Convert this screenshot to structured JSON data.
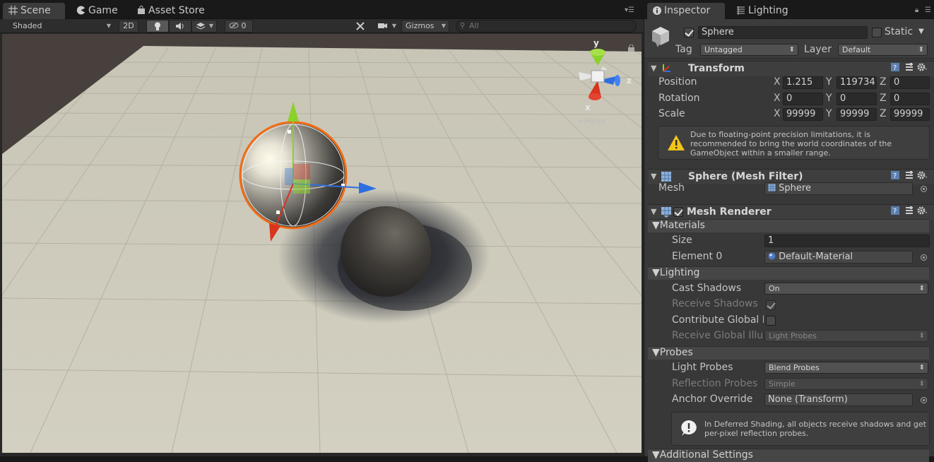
{
  "scene_tabs": [
    {
      "label": "Scene",
      "icon": "grid-icon"
    },
    {
      "label": "Game",
      "icon": "pacman-icon"
    },
    {
      "label": "Asset Store",
      "icon": "bag-icon"
    }
  ],
  "scene_toolbar": {
    "draw_mode": "Shaded",
    "mode_2d": "2D",
    "hidden_count": "0",
    "gizmos": "Gizmos",
    "search_placeholder": "All"
  },
  "viewport": {
    "gizmo_axes": {
      "y": "y",
      "z": "z",
      "x": "x"
    },
    "projection_label": "Persp"
  },
  "inspector_tabs": [
    {
      "label": "Inspector",
      "icon": "info-icon"
    },
    {
      "label": "Lighting",
      "icon": "lighting-icon"
    }
  ],
  "object": {
    "active": true,
    "name": "Sphere",
    "static_label": "Static",
    "static": false,
    "tag_label": "Tag",
    "tag": "Untagged",
    "layer_label": "Layer",
    "layer": "Default"
  },
  "transform": {
    "title": "Transform",
    "position_label": "Position",
    "rotation_label": "Rotation",
    "scale_label": "Scale",
    "axis_x": "X",
    "axis_y": "Y",
    "axis_z": "Z",
    "position": {
      "x": "1.215",
      "y": "119734",
      "z": "0"
    },
    "rotation": {
      "x": "0",
      "y": "0",
      "z": "0"
    },
    "scale": {
      "x": "99999",
      "y": "99999",
      "z": "99999"
    },
    "warning": "Due to floating-point precision limitations, it is recommended to bring the world coordinates of the GameObject within a smaller range."
  },
  "mesh_filter": {
    "title": "Sphere (Mesh Filter)",
    "mesh_label": "Mesh",
    "mesh": "Sphere"
  },
  "mesh_renderer": {
    "title": "Mesh Renderer",
    "enabled": true,
    "materials_header": "Materials",
    "size_label": "Size",
    "size": "1",
    "element0_label": "Element 0",
    "element0": "Default-Material",
    "lighting_header": "Lighting",
    "cast_shadows_label": "Cast Shadows",
    "cast_shadows": "On",
    "receive_shadows_label": "Receive Shadows",
    "receive_shadows": true,
    "contribute_gi_label": "Contribute Global I",
    "contribute_gi": false,
    "receive_gi_label": "Receive Global Illur",
    "receive_gi": "Light Probes",
    "probes_header": "Probes",
    "light_probes_label": "Light Probes",
    "light_probes": "Blend Probes",
    "reflection_probes_label": "Reflection Probes",
    "reflection_probes": "Simple",
    "anchor_override_label": "Anchor Override",
    "anchor_override": "None (Transform)",
    "info": "In Deferred Shading, all objects receive shadows and get per-pixel reflection probes.",
    "additional_settings": "Additional Settings"
  },
  "colors": {
    "selection_outline": "#f26b14",
    "gizmo_x": "#d8341e",
    "gizmo_y": "#8bd12b",
    "gizmo_z": "#2d6fe0",
    "floor": "#cbc8b9"
  }
}
